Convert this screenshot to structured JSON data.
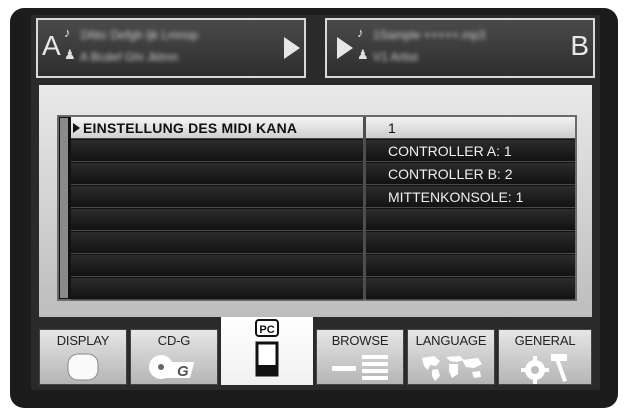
{
  "deck_a": {
    "letter": "A",
    "title": "2Abc Defgh Ijk Lmnop",
    "artist": "A Bcdef Ghi Jklmn"
  },
  "deck_b": {
    "letter": "B",
    "title": "1Sample +++++.mp3",
    "artist": "V1 Artist"
  },
  "menu": {
    "items": [
      "EINSTELLUNG DES MIDI KANA",
      "",
      "",
      "",
      "",
      "",
      "",
      ""
    ],
    "options": [
      "1",
      "CONTROLLER A: 1",
      "CONTROLLER B: 2",
      "MITTENKONSOLE: 1",
      "",
      "",
      "",
      ""
    ]
  },
  "tabs": [
    {
      "label": "DISPLAY",
      "icon": "display-icon"
    },
    {
      "label": "CD-G",
      "icon": "cdg-icon"
    },
    {
      "label": "PC",
      "icon": "pc-icon"
    },
    {
      "label": "BROWSE",
      "icon": "browse-icon"
    },
    {
      "label": "LANGUAGE",
      "icon": "world-map-icon"
    },
    {
      "label": "GENERAL",
      "icon": "tools-icon"
    }
  ]
}
